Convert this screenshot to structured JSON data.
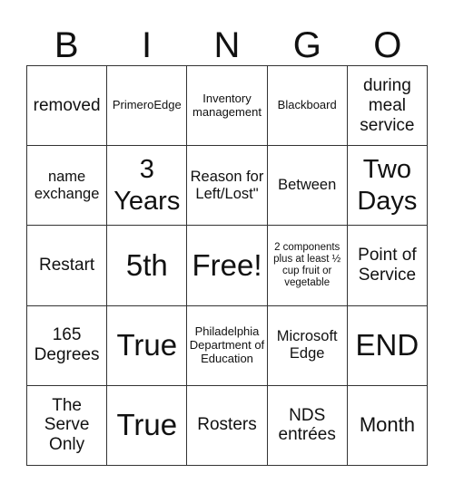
{
  "header": {
    "letters": [
      "B",
      "I",
      "N",
      "G",
      "O"
    ]
  },
  "board": {
    "rows": [
      [
        "removed",
        "PrimeroEdge",
        "Inventory management",
        "Blackboard",
        "during meal service"
      ],
      [
        "name exchange",
        "3 Years",
        "Reason for Left/Lost\"",
        "Between",
        "Two Days"
      ],
      [
        "Restart",
        "5th",
        "Free!",
        "2 components plus at least ½ cup fruit or vegetable",
        "Point of Service"
      ],
      [
        "165 Degrees",
        "True",
        "Philadelphia Department of Education",
        "Microsoft Edge",
        "END"
      ],
      [
        "The Serve Only",
        "True",
        "Rosters",
        "NDS entrées",
        "Month"
      ]
    ],
    "free_space": "Free!"
  }
}
